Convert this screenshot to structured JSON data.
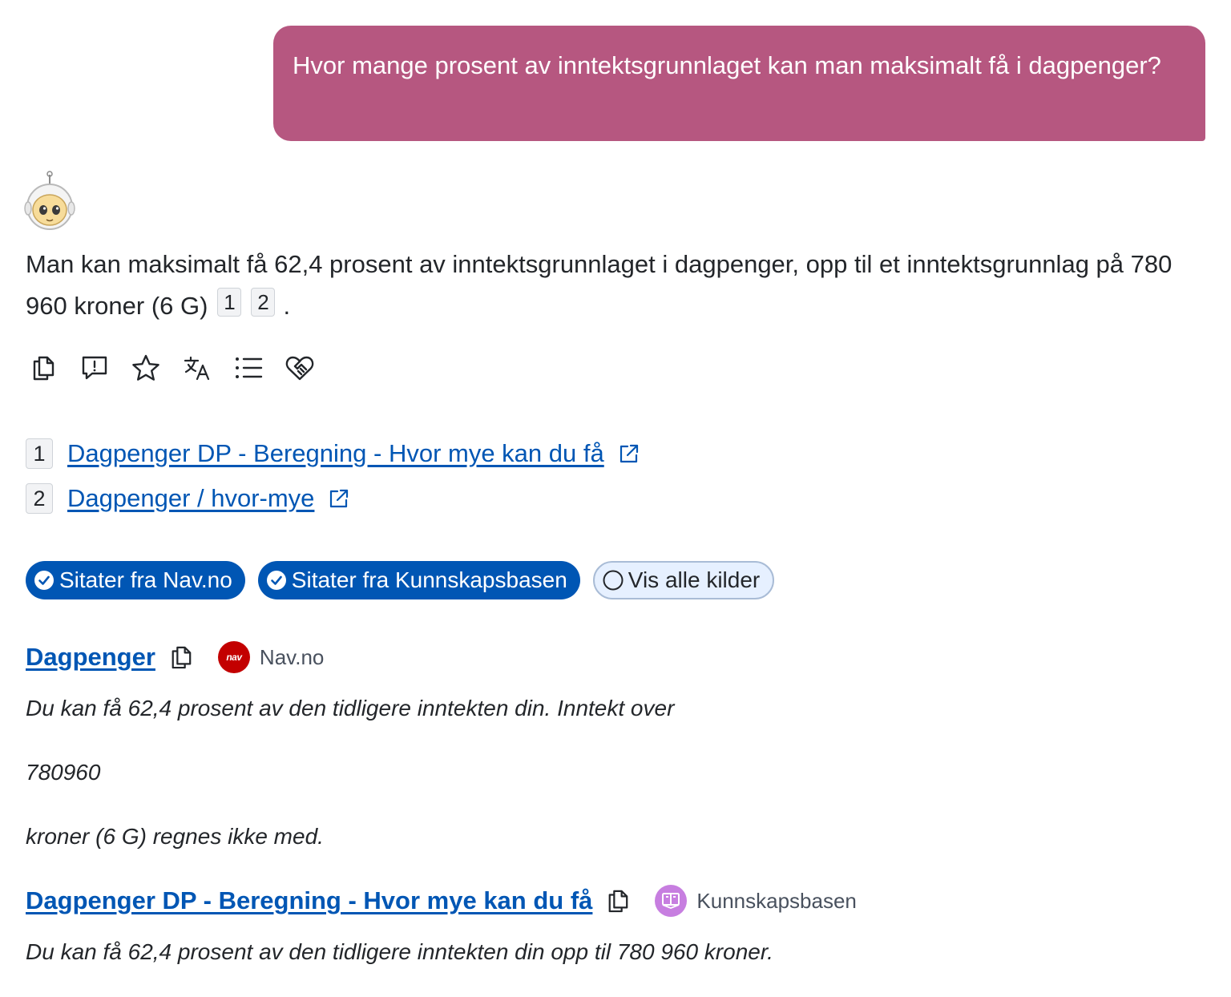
{
  "colors": {
    "user_bubble": "#b65780",
    "link": "#0056b4",
    "chip_active": "#0056b4",
    "chip_inactive_bg": "#e6f0ff",
    "nav_logo": "#c30000",
    "kunnskapsbasen_logo": "#c77ee0"
  },
  "question": "Hvor mange prosent av inntektsgrunnlaget kan man maksimalt få i dagpenger?",
  "answer": {
    "text": "Man kan maksimalt få 62,4 prosent av inntektsgrunnlaget i dagpenger, opp til et inntektsgrunnlag på 780 960 kroner (6 G)",
    "citations": [
      "1",
      "2"
    ],
    "end": "."
  },
  "actions": [
    {
      "icon": "copy-icon"
    },
    {
      "icon": "report-icon"
    },
    {
      "icon": "star-icon"
    },
    {
      "icon": "translate-icon"
    },
    {
      "icon": "list-icon"
    },
    {
      "icon": "handshake-heart-icon"
    }
  ],
  "sources": [
    {
      "num": "1",
      "label": "Dagpenger DP - Beregning - Hvor mye kan du få"
    },
    {
      "num": "2",
      "label": "Dagpenger / hvor-mye"
    }
  ],
  "chips": [
    {
      "label": "Sitater fra Nav.no",
      "checked": true
    },
    {
      "label": "Sitater fra Kunnskapsbasen",
      "checked": true
    },
    {
      "label": "Vis alle kilder",
      "checked": false
    }
  ],
  "citation_blocks": [
    {
      "title": "Dagpenger",
      "source": "Nav.no",
      "logo_text": "nav",
      "lines": [
        "Du kan få 62,4 prosent av den tidligere inntekten din. Inntekt over",
        "780960",
        "kroner (6 G) regnes ikke med."
      ]
    },
    {
      "title": "Dagpenger DP - Beregning - Hvor mye kan du få",
      "source": "Kunnskapsbasen",
      "lines": [
        "Du kan få 62,4 prosent av den tidligere inntekten din opp til 780 960 kroner."
      ]
    }
  ]
}
